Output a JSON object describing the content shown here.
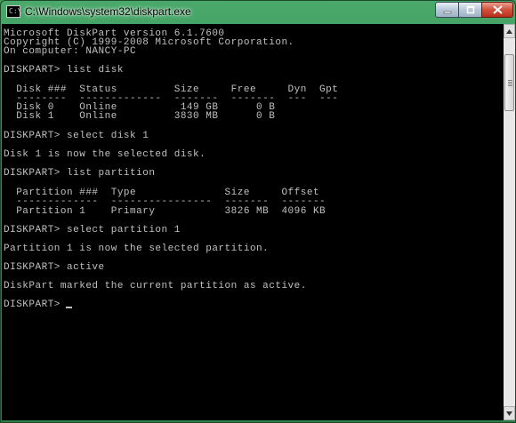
{
  "window": {
    "title": "C:\\Windows\\system32\\diskpart.exe",
    "icon": "console-icon"
  },
  "controls": {
    "minimize_icon": "minimize-icon",
    "maximize_icon": "maximize-icon",
    "close_icon": "close-icon"
  },
  "console": {
    "lines": [
      "Microsoft DiskPart version 6.1.7600",
      "Copyright (C) 1999-2008 Microsoft Corporation.",
      "On computer: NANCY-PC",
      "DISKPART> list disk",
      "  Disk ###  Status         Size     Free     Dyn  Gpt",
      "  --------  -------------  -------  -------  ---  ---",
      "  Disk 0    Online          149 GB      0 B",
      "  Disk 1    Online         3830 MB      0 B",
      "DISKPART> select disk 1",
      "Disk 1 is now the selected disk.",
      "DISKPART> list partition",
      "  Partition ###  Type              Size     Offset",
      "  -------------  ----------------  -------  -------",
      "  Partition 1    Primary           3826 MB  4096 KB",
      "DISKPART> select partition 1",
      "Partition 1 is now the selected partition.",
      "DISKPART> active",
      "DiskPart marked the current partition as active.",
      "DISKPART> "
    ]
  }
}
